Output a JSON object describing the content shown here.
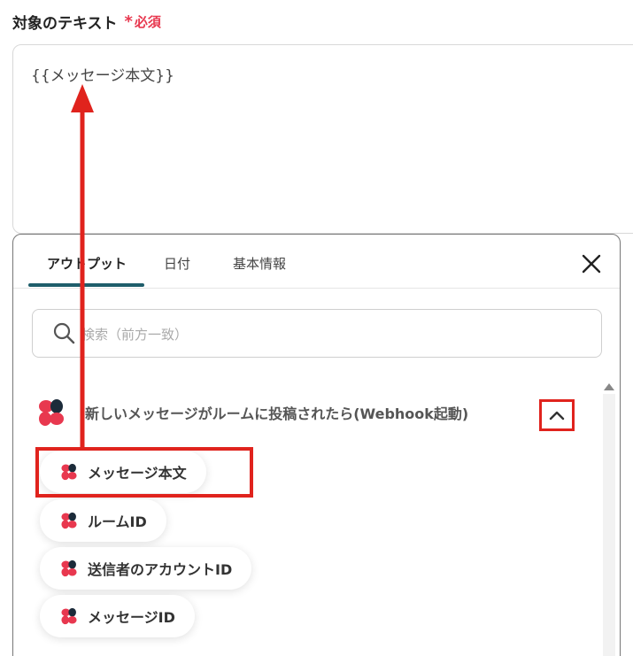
{
  "field": {
    "label": "対象のテキスト",
    "required_star": "*",
    "required_text": "必須",
    "value": "{{メッセージ本文}}"
  },
  "panel": {
    "tabs": [
      {
        "label": "アウトプット",
        "active": true
      },
      {
        "label": "日付",
        "active": false
      },
      {
        "label": "基本情報",
        "active": false
      }
    ],
    "close_icon": "close-icon",
    "search": {
      "placeholder": "検索（前方一致）",
      "icon": "search-icon"
    },
    "group": {
      "title": "新しいメッセージがルームに投稿されたら(Webhook起動)",
      "collapse_icon": "chevron-up-icon",
      "items": [
        {
          "label": "メッセージ本文"
        },
        {
          "label": "ルームID"
        },
        {
          "label": "送信者のアカウントID"
        },
        {
          "label": "メッセージID"
        }
      ]
    }
  },
  "colors": {
    "accent": "#e0231d",
    "required": "#e8384f",
    "tab_underline": "#1f5e6b",
    "logo_red": "#e8384f",
    "logo_dark": "#1c2b3a"
  }
}
